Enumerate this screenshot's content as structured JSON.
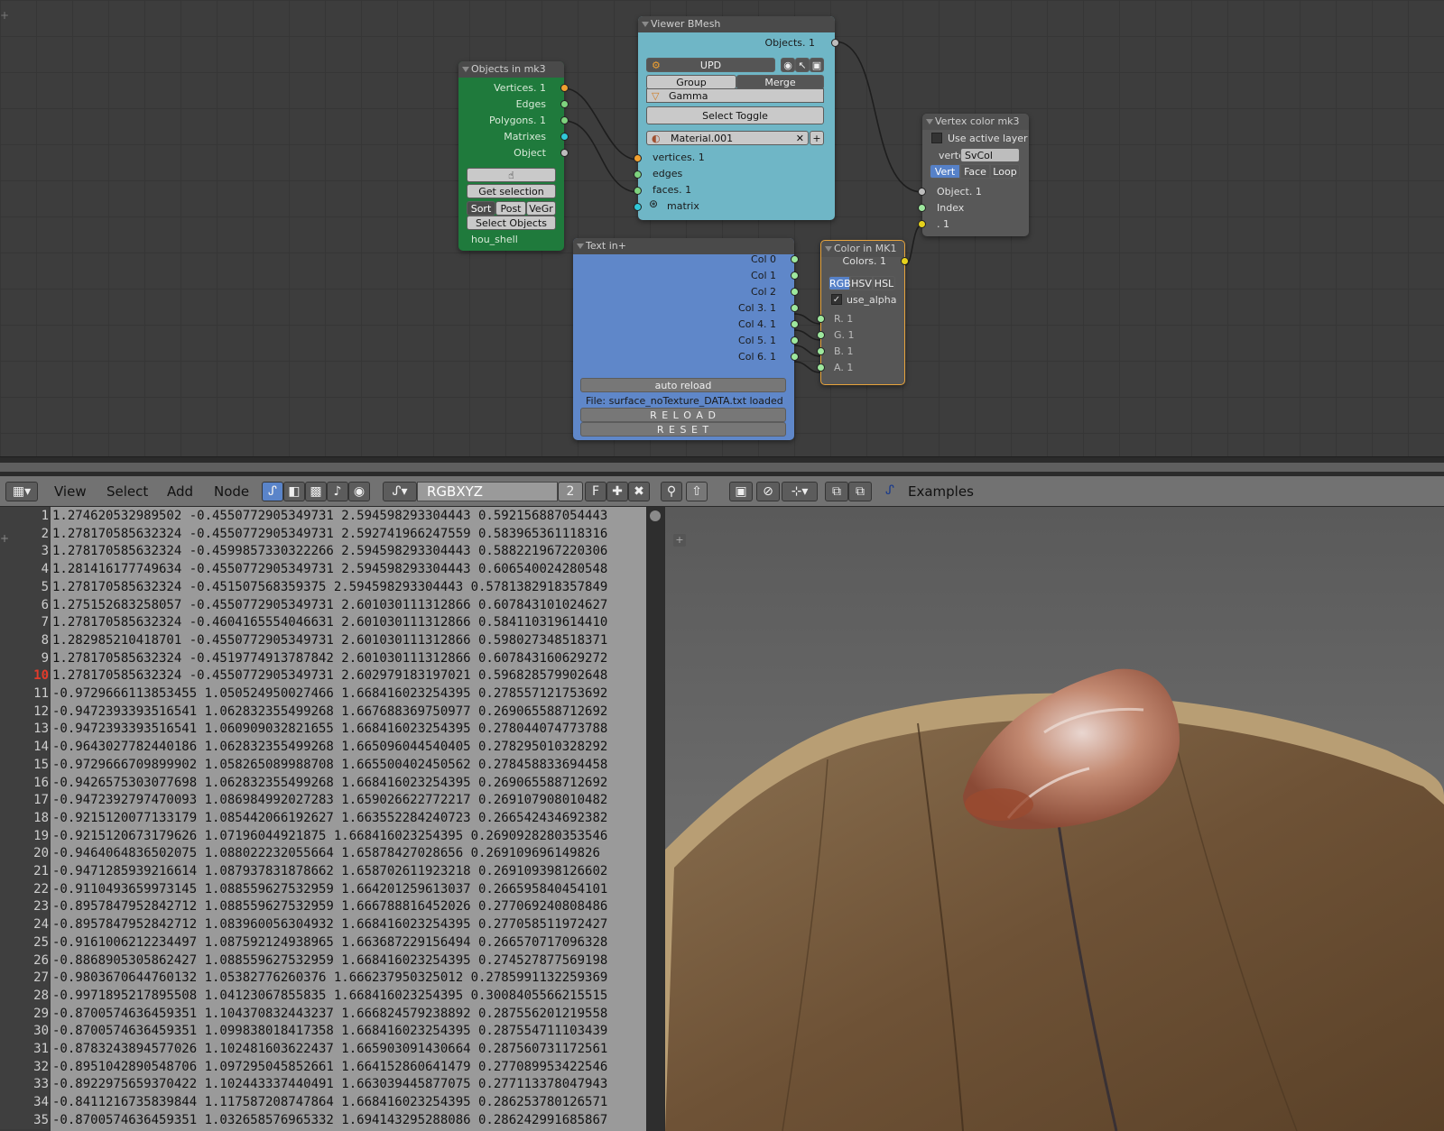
{
  "nodes": {
    "objects_in": {
      "title": "Objects in mk3",
      "outputs": [
        "Vertices. 1",
        "Edges",
        "Polygons. 1",
        "Matrixes",
        "Object"
      ],
      "get_selection": "Get selection",
      "tabs": [
        "Sort",
        "Post",
        "VeGr"
      ],
      "select_objects": "Select Objects",
      "object_name": "hou_shell"
    },
    "viewer": {
      "title": "Viewer BMesh",
      "output": "Objects. 1",
      "upd": "UPD",
      "group": "Group",
      "merge": "Merge",
      "gamma": "Gamma",
      "select_toggle": "Select Toggle",
      "material": "Material.001",
      "inputs": [
        "vertices. 1",
        "edges",
        "faces. 1",
        "matrix"
      ]
    },
    "text_in": {
      "title": "Text in+",
      "outputs": [
        "Col 0",
        "Col 1",
        "Col 2",
        "Col 3. 1",
        "Col 4. 1",
        "Col 5. 1",
        "Col 6. 1"
      ],
      "auto_reload": "auto reload",
      "file_status": "File: surface_noTexture_DATA.txt loaded",
      "reload": "R E L O A D",
      "reset": "R E S E T"
    },
    "color_in": {
      "title": "Color in MK1",
      "output": "Colors. 1",
      "modes": [
        "RGB",
        "HSV",
        "HSL"
      ],
      "use_alpha": "use_alpha",
      "inputs": [
        "R. 1",
        "G. 1",
        "B. 1",
        "A. 1"
      ]
    },
    "vertex_color": {
      "title": "Vertex color mk3",
      "use_active_layer": "Use active layer",
      "verte_label": "verte",
      "verte_value": "SvCol",
      "modes": [
        "Vert",
        "Face",
        "Loop"
      ],
      "inputs": [
        "Object. 1",
        "Index",
        ". 1"
      ]
    }
  },
  "header": {
    "menu": [
      "View",
      "Select",
      "Add",
      "Node"
    ],
    "tree_name": "RGBXYZ",
    "users": "2",
    "fake_user": "F",
    "examples": "Examples"
  },
  "editor": {
    "current_line": 10,
    "lines": [
      "1.274620532989502 -0.4550772905349731 2.594598293304443 0.592156887054443",
      "1.278170585632324 -0.4550772905349731 2.592741966247559 0.583965361118316",
      "1.278170585632324 -0.4599857330322266 2.594598293304443 0.588221967220306",
      "1.281416177749634 -0.4550772905349731 2.594598293304443 0.606540024280548",
      "1.278170585632324 -0.451507568359375 2.594598293304443 0.5781382918357849",
      "1.275152683258057 -0.4550772905349731 2.601030111312866 0.607843101024627",
      "1.278170585632324 -0.4604165554046631 2.601030111312866 0.584110319614410",
      "1.282985210418701 -0.4550772905349731 2.601030111312866 0.598027348518371",
      "1.278170585632324 -0.4519774913787842 2.601030111312866 0.607843160629272",
      "1.278170585632324 -0.4550772905349731 2.602979183197021 0.596828579902648",
      "-0.9729666113853455 1.050524950027466 1.668416023254395 0.278557121753692",
      "-0.9472393393516541 1.062832355499268 1.667688369750977 0.269065588712692",
      "-0.9472393393516541 1.060909032821655 1.668416023254395 0.278044074773788",
      "-0.9643027782440186 1.062832355499268 1.665096044540405 0.278295010328292",
      "-0.9729666709899902 1.058265089988708 1.665500402450562 0.278458833694458",
      "-0.9426575303077698 1.062832355499268 1.668416023254395 0.269065588712692",
      "-0.9472392797470093 1.086984992027283 1.659026622772217 0.269107908010482",
      "-0.9215120077133179 1.085442066192627 1.663552284240723 0.266542434692382",
      "-0.9215120673179626 1.07196044921875 1.668416023254395 0.2690928280353546",
      "-0.9464064836502075 1.088022232055664 1.65878427028656 0.269109696149826",
      "-0.9471285939216614 1.087937831878662 1.658702611923218 0.269109398126602",
      "-0.9110493659973145 1.088559627532959 1.664201259613037 0.266595840454101",
      "-0.8957847952842712 1.088559627532959 1.666788816452026 0.277069240808486",
      "-0.8957847952842712 1.083960056304932 1.668416023254395 0.277058511972427",
      "-0.9161006212234497 1.087592124938965 1.663687229156494 0.266570717096328",
      "-0.8868905305862427 1.088559627532959 1.668416023254395 0.274527877569198",
      "-0.9803670644760132 1.05382776260376 1.666237950325012 0.2785991132259369",
      "-0.9971895217895508 1.04123067855835 1.668416023254395 0.3008405566215515",
      "-0.8700574636459351 1.104370832443237 1.666824579238892 0.287556201219558",
      "-0.8700574636459351 1.099838018417358 1.668416023254395 0.287554711103439",
      "-0.8783243894577026 1.102481603622437 1.665903091430664 0.287560731172561",
      "-0.8951042890548706 1.097295045852661 1.664152860641479 0.277089953422546",
      "-0.8922975659370422 1.102443337440491 1.663039445877075 0.277113378047943",
      "-0.8411216735839844 1.117587208747864 1.668416023254395 0.286253780126571",
      "-0.8700574636459351 1.032658576965332 1.694143295288086 0.286242991685867"
    ]
  }
}
